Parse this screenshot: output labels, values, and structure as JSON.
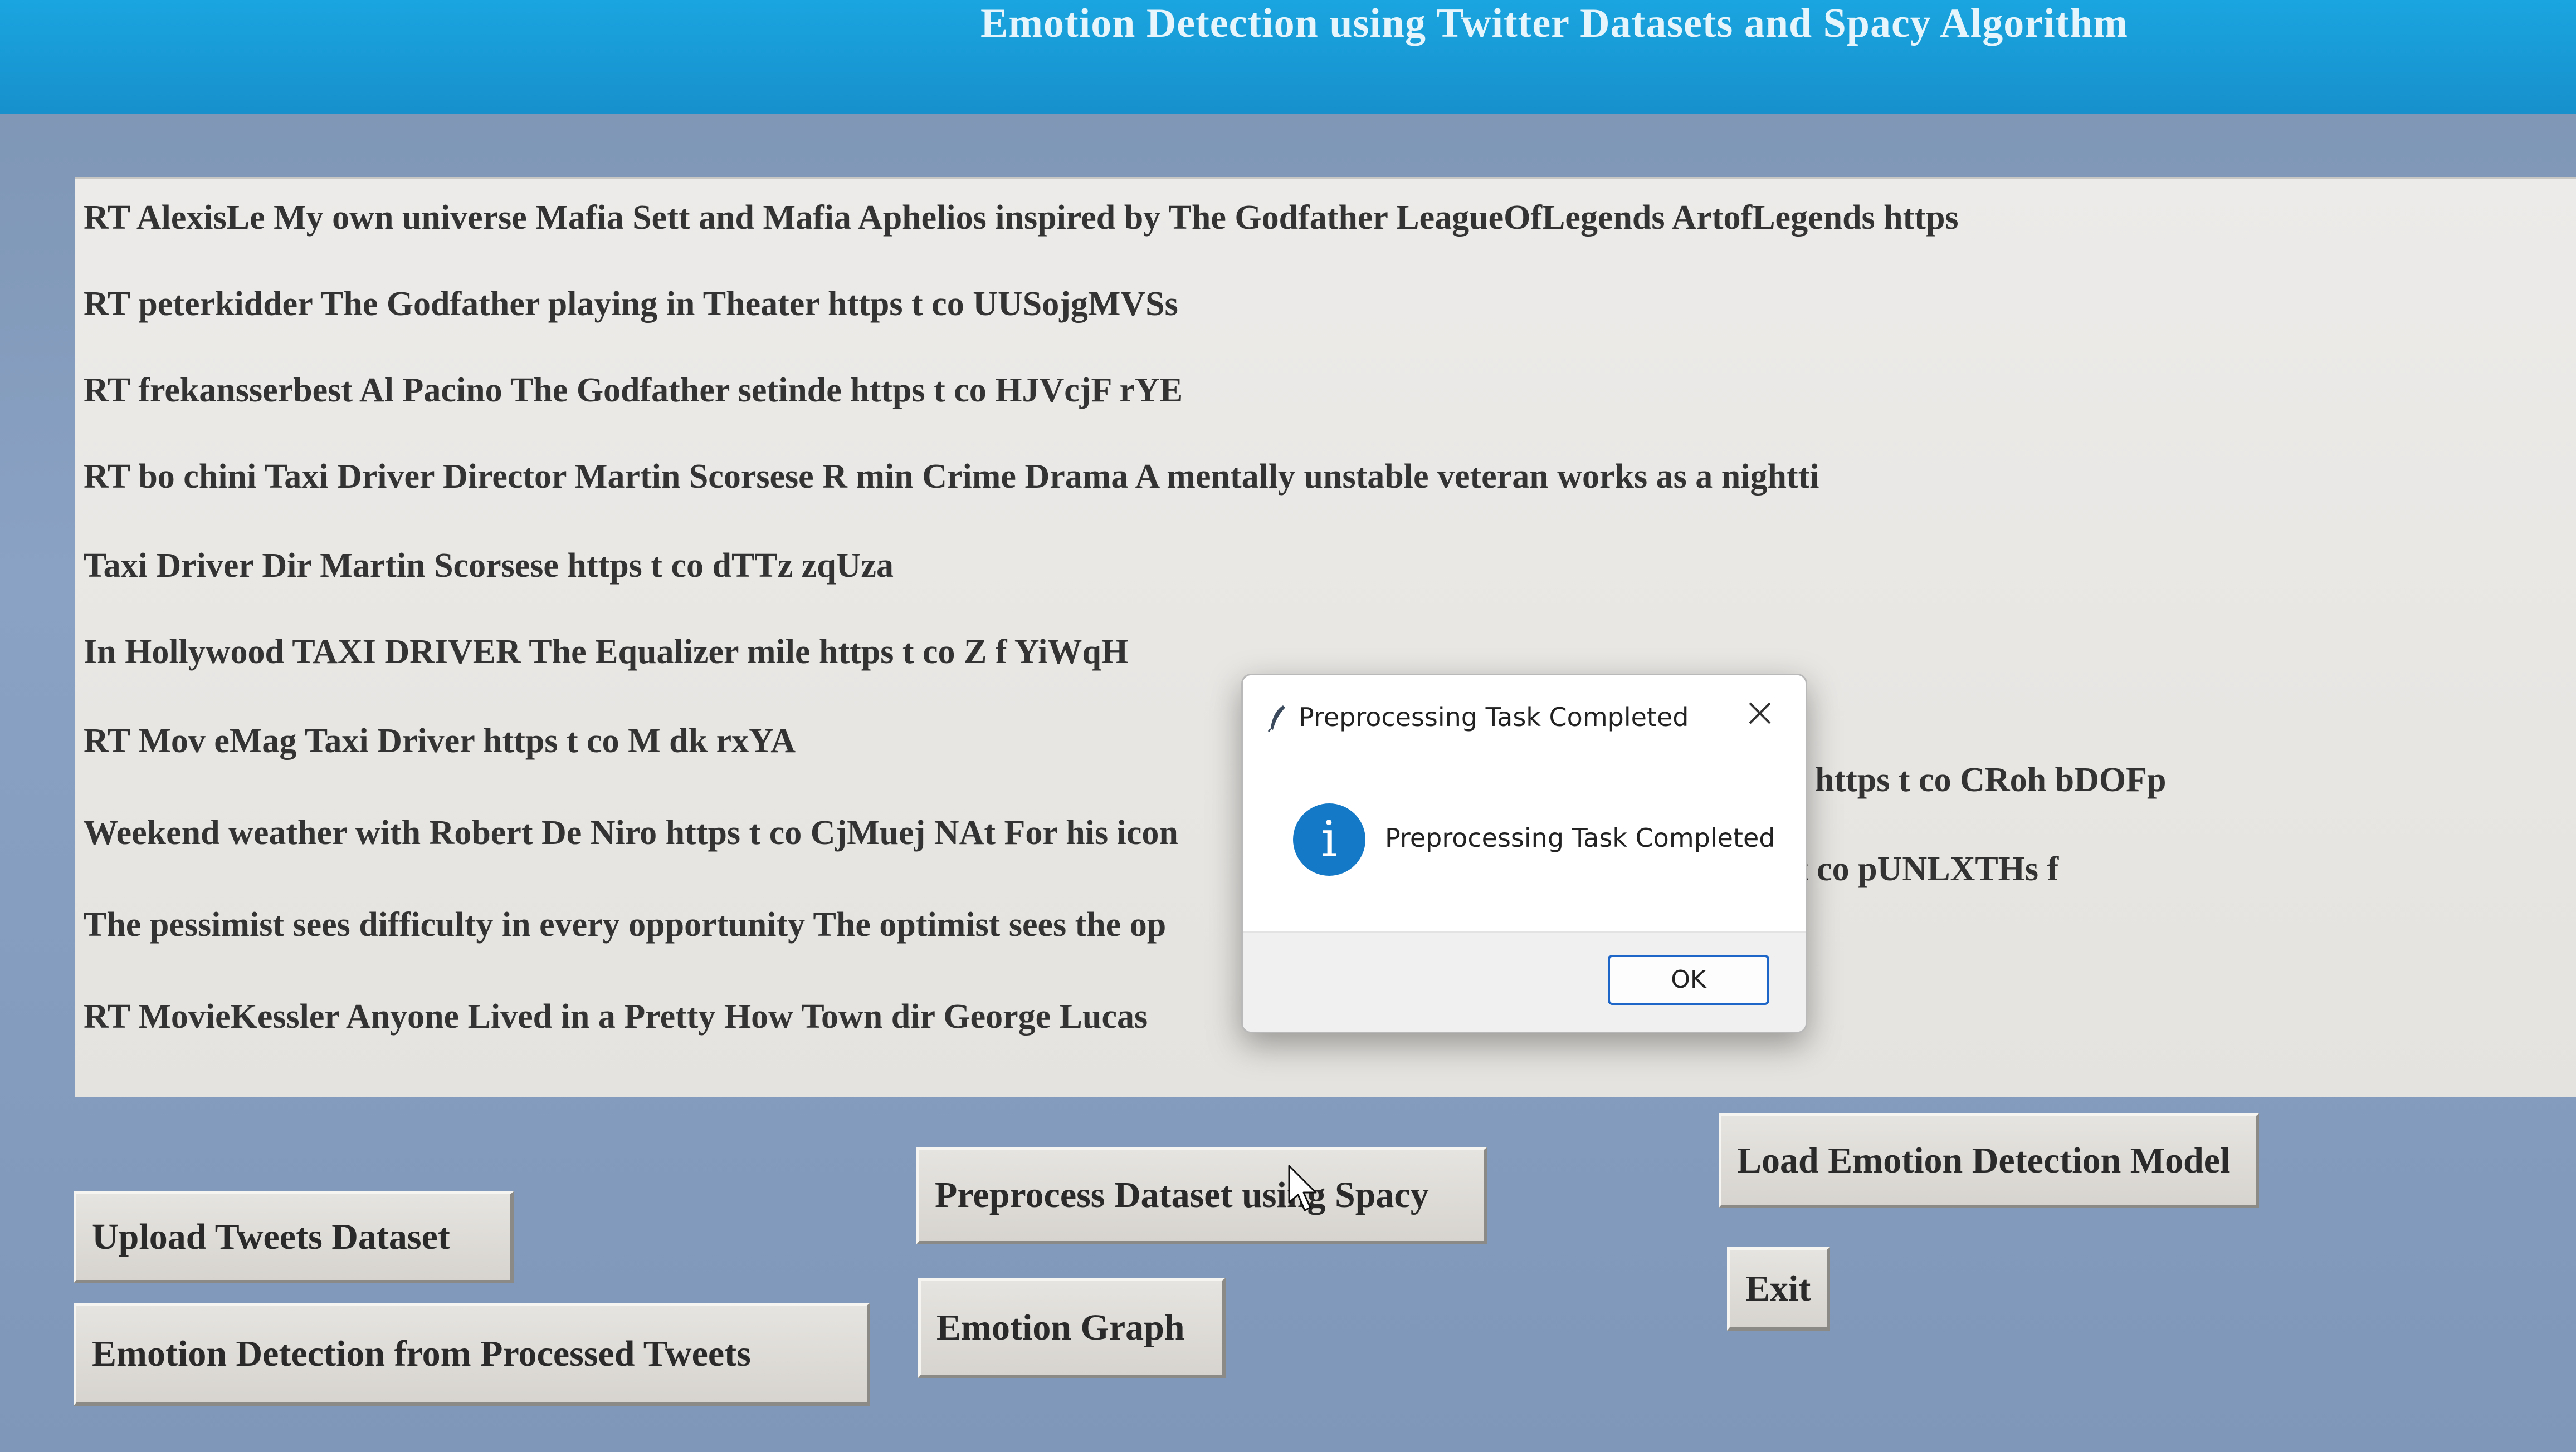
{
  "window": {
    "title": "Emotion Detection using Twitter Datasets and Spacy Algorithm"
  },
  "tweets": [
    "RT AlexisLe My own universe Mafia Sett and Mafia Aphelios inspired by The Godfather LeagueOfLegends ArtofLegends https",
    "RT peterkidder The Godfather playing in Theater https t co UUSojgMVSs",
    "RT frekansserbest Al Pacino The Godfather setinde https t co HJVcjF rYE",
    "RT bo chini Taxi Driver Director Martin Scorsese R min Crime Drama A mentally unstable veteran works as a nightti",
    "Taxi Driver Dir Martin Scorsese https t co dTTz zqUza",
    "In Hollywood TAXI DRIVER The Equalizer mile https t co Z f YiWqH",
    "RT Mov eMag Taxi Driver https t co M dk rxYA",
    "Weekend weather with Robert De Niro https t co CjMuej NAt For his icon",
    "The pessimist sees difficulty in every opportunity The optimist sees the op",
    "RT MovieKessler Anyone Lived in a Pretty How Town dir George Lucas"
  ],
  "tweet_fragments": {
    "line8_tail": "e https t co CRoh bDOFp",
    "line9_tail": "t co pUNLXTHs f"
  },
  "buttons": {
    "upload": "Upload Tweets Dataset",
    "preprocess": "Preprocess Dataset using Spacy",
    "load_model": "Load Emotion Detection Model",
    "detect": "Emotion Detection from Processed Tweets",
    "graph": "Emotion Graph",
    "exit": "Exit"
  },
  "dialog": {
    "title": "Preprocessing Task Completed",
    "message": "Preprocessing Task Completed",
    "ok": "OK",
    "icon": "info-icon"
  },
  "colors": {
    "title_bar": "#1aa5e0",
    "background": "#8aa2c4",
    "text_area": "#ecebe9",
    "info_icon": "#1479c6",
    "ok_border": "#1e67c8"
  }
}
